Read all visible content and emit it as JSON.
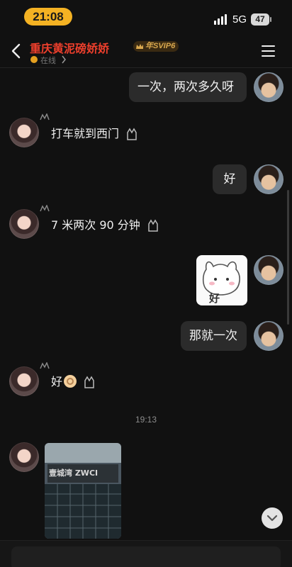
{
  "status_bar": {
    "time": "21:08",
    "network": "5G",
    "battery": "47"
  },
  "header": {
    "title": "重庆黄泥磅娇娇",
    "badge": "年SVIP6",
    "subtitle": "在线"
  },
  "messages": [
    {
      "side": "out",
      "type": "text",
      "text": "一次，两次多久呀"
    },
    {
      "side": "in",
      "type": "text",
      "text": "打车就到西门"
    },
    {
      "side": "out",
      "type": "text",
      "text": "好"
    },
    {
      "side": "in",
      "type": "text",
      "text": "7 米两次 90 分钟"
    },
    {
      "side": "out",
      "type": "sticker",
      "text": "好"
    },
    {
      "side": "out",
      "type": "text",
      "text": "那就一次"
    },
    {
      "side": "in",
      "type": "text",
      "text": "好"
    },
    {
      "side": "in",
      "type": "image",
      "sign_text": "壹城湾 ZWCI"
    }
  ],
  "timestamp": "19:13",
  "colors": {
    "accent": "#f4b223",
    "title_red": "#ee3f2c",
    "background": "#111111",
    "bubble": "#2b2b2b"
  },
  "icons": [
    "back-arrow-icon",
    "hamburger-menu-icon",
    "chevron-down-icon",
    "signal-icon",
    "battery-icon"
  ]
}
